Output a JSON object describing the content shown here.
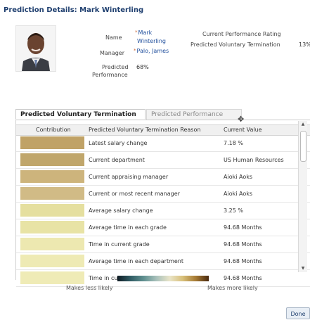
{
  "dialog": {
    "title": "Prediction Details: Mark Winterling",
    "done_label": "Done"
  },
  "employee": {
    "name_label": "Name",
    "name_value_line1": "Mark",
    "name_value_line2": "Winterling",
    "manager_label": "Manager",
    "manager_value": "Palo, James",
    "predicted_performance_label_line1": "Predicted",
    "predicted_performance_label_line2": "Performance",
    "predicted_performance_value": "68%",
    "current_rating_label": "Current Performance Rating",
    "predicted_vt_label": "Predicted Voluntary Termination",
    "predicted_vt_value": "13%"
  },
  "tabs": [
    {
      "label": "Predicted Voluntary Termination",
      "active": true
    },
    {
      "label": "Predicted Performance",
      "active": false
    }
  ],
  "table": {
    "headers": {
      "contribution": "Contribution",
      "reason": "Predicted Voluntary Termination Reason",
      "value": "Current Value"
    },
    "rows": [
      {
        "color": "#c0a266",
        "reason": "Latest salary change",
        "value": "7.18 %"
      },
      {
        "color": "#c0a66b",
        "reason": "Current department",
        "value": "US Human Resources"
      },
      {
        "color": "#cdb47c",
        "reason": "Current appraising manager",
        "value": "Aioki Aoks"
      },
      {
        "color": "#d1bb86",
        "reason": "Current or most recent manager",
        "value": "Aioki Aoks"
      },
      {
        "color": "#e5df9f",
        "reason": "Average salary change",
        "value": "3.25 %"
      },
      {
        "color": "#e8e3a5",
        "reason": "Average time in each grade",
        "value": "94.68 Months"
      },
      {
        "color": "#ede8b0",
        "reason": "Time in current grade",
        "value": "94.68 Months"
      },
      {
        "color": "#eeeab4",
        "reason": "Average time in each department",
        "value": "94.68 Months"
      },
      {
        "color": "#efebb6",
        "reason": "Time in current department",
        "value": "94.68 Months"
      }
    ]
  },
  "legend": {
    "left_label": "Makes less likely",
    "right_label": "Makes more likely"
  }
}
